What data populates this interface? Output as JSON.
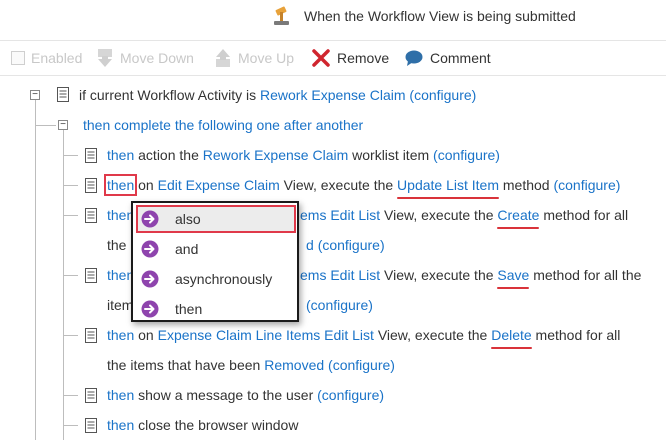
{
  "header": {
    "title": "When the Workflow View is being submitted",
    "icon": "gavel-icon"
  },
  "toolbar": {
    "enabled_label": "Enabled",
    "move_down_label": "Move Down",
    "move_up_label": "Move Up",
    "remove_label": "Remove",
    "comment_label": "Comment"
  },
  "tree": {
    "row0": {
      "t1": "if current Workflow Activity is ",
      "link1": "Rework Expense Claim",
      "link2": "(configure)"
    },
    "row1": {
      "link1": "then complete the following one after another"
    },
    "row2": {
      "link1": "then",
      "t1": " action the ",
      "link2": "Rework Expense Claim",
      "t2": " worklist item ",
      "link3": "(configure)"
    },
    "row3": {
      "link1": "then",
      "t1": " on ",
      "link2": "Edit Expense Claim",
      "t2": " View, execute the ",
      "link3": "Update List Item",
      "t3": " method ",
      "link4": "(configure)"
    },
    "row4": {
      "link1": "then",
      "link2": "ems Edit List",
      "t1": " View, execute the ",
      "link3": "Create",
      "t2": " method for all"
    },
    "row4b": {
      "t1": "the",
      "link1": "d",
      "link2": "(configure)"
    },
    "row5": {
      "link1": "then",
      "link2": "ems Edit List",
      "t1": " View, execute the ",
      "link3": "Save",
      "t2": " method for all the"
    },
    "row5b": {
      "t1": "item",
      "link1": "(configure)"
    },
    "row6": {
      "link1": "then",
      "t1": " on ",
      "link2": "Expense Claim Line Items Edit List",
      "t2": " View, execute the ",
      "link3": "Delete",
      "t3": " method for all"
    },
    "row6b": {
      "t1": "the items that have been ",
      "link1": "Removed",
      "link2": "(configure)"
    },
    "row7": {
      "link1": "then",
      "t1": " show a message to the user ",
      "link2": "(configure)"
    },
    "row8": {
      "link1": "then",
      "t1": " close the browser window"
    }
  },
  "popup_menu": {
    "items": [
      {
        "label": "also",
        "selected": true
      },
      {
        "label": "and"
      },
      {
        "label": "asynchronously"
      },
      {
        "label": "then"
      }
    ]
  },
  "colors": {
    "link": "#1a73c8",
    "highlight": "#d9333a",
    "menu_icon": "#8e44ad"
  }
}
